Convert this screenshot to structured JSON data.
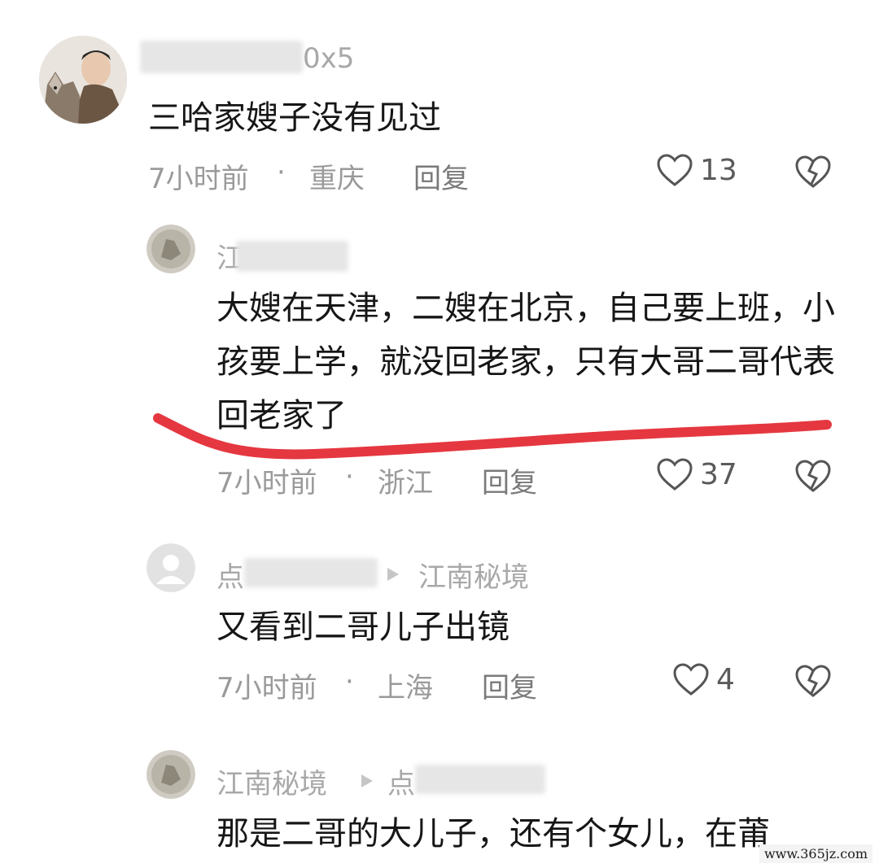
{
  "comments": [
    {
      "name_visible": "0x5",
      "text": "三哈家嫂子没有见过",
      "time": "7小时前",
      "sep": "·",
      "location": "重庆",
      "reply": "回复",
      "likes": "13"
    },
    {
      "name_visible": "江",
      "text": "大嫂在天津，二嫂在北京，自己要上班，小孩要上学，就没回老家，只有大哥二哥代表回老家了",
      "time": "7小时前",
      "sep": "·",
      "location": "浙江",
      "reply": "回复",
      "likes": "37"
    },
    {
      "name_visible": "点",
      "reply_to": "江南秘境",
      "text": "又看到二哥儿子出镜",
      "time": "7小时前",
      "sep": "·",
      "location": "上海",
      "reply": "回复",
      "likes": "4"
    },
    {
      "name_visible": "江南秘境",
      "reply_to": "点",
      "text": "那是二哥的大儿子，还有个女儿，在莆",
      "time": "",
      "location": "",
      "reply": "",
      "likes": ""
    }
  ],
  "watermark": "www.365jz.com",
  "colors": {
    "annotation_stroke": "#e53740",
    "meta": "#9a9a9a",
    "text": "#161616"
  }
}
